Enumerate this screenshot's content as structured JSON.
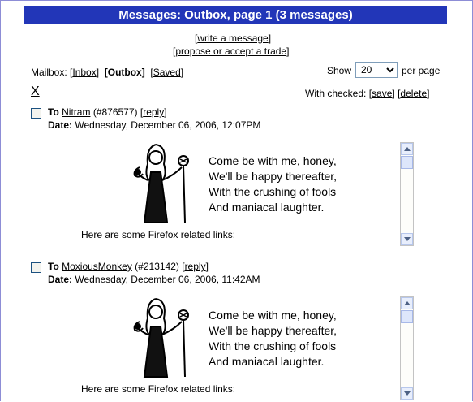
{
  "title": "Messages: Outbox, page 1 (3 messages)",
  "actions": {
    "write": "write a message",
    "propose": "propose or accept a trade"
  },
  "mailbox": {
    "label": "Mailbox:",
    "inbox": "Inbox",
    "outbox": "Outbox",
    "saved": "Saved"
  },
  "show": {
    "label": "Show",
    "value": "20",
    "suffix": "per page"
  },
  "toggle_all": "X",
  "with_checked": {
    "label": "With checked:",
    "save": "save",
    "delete": "delete"
  },
  "messages": [
    {
      "to_label": "To",
      "recipient": "Nitram",
      "id": "(#876577)",
      "reply": "reply",
      "date_label": "Date:",
      "date": "Wednesday, December 06, 2006, 12:07PM",
      "poem": [
        "Come be with me, honey,",
        "We'll be happy thereafter,",
        "With the crushing of fools",
        "And maniacal laughter."
      ],
      "footer": "Here are some Firefox related links:"
    },
    {
      "to_label": "To",
      "recipient": "MoxiousMonkey",
      "id": "(#213142)",
      "reply": "reply",
      "date_label": "Date:",
      "date": "Wednesday, December 06, 2006, 11:42AM",
      "poem": [
        "Come be with me, honey,",
        "We'll be happy thereafter,",
        "With the crushing of fools",
        "And maniacal laughter."
      ],
      "footer": "Here are some Firefox related links:"
    }
  ],
  "colors": {
    "header": "#2236b8",
    "border": "#2236b8"
  },
  "icons": {
    "figure": "sorceress-drawing",
    "checkbox": "checkbox-icon"
  }
}
